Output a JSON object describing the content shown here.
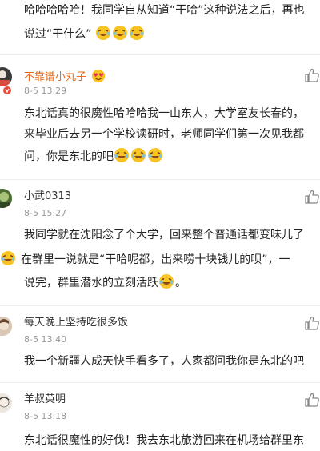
{
  "top": {
    "line1": "哈哈哈哈哈！我同学自从知道“干哈”这种说法之后，再也",
    "line2": "说过“干什么”"
  },
  "comments": [
    {
      "user": "不靠谱小丸子",
      "time": "8-5 13:29",
      "lines": [
        "东北话真的很魔性哈哈哈我一山东人，大学室友长春的，",
        "来毕业后去另一个学校读研时，老师同学们第一次见我都",
        "问，你是东北的吧"
      ]
    },
    {
      "user": "小武0313",
      "time": "8-5 15:27",
      "lines": [
        "我同学就在沈阳念了个大学，回来整个普通话都变味儿了",
        "在群里一说就是“干哈呢都，出来唠十块钱儿的呗”，一",
        "说完，群里潜水的立刻活跃",
        "。"
      ]
    },
    {
      "user": "每天晚上坚持吃很多饭",
      "time": "8-5 13:40",
      "lines": [
        "我一个新疆人成天快手看多了，人家都问我你是东北的吧"
      ]
    },
    {
      "user": "羊叔英明",
      "time": "8-5 13:18",
      "lines": [
        "东北话很魔性的好伐！我去东北旅游回来在机场给群里东"
      ]
    }
  ],
  "icons": {
    "emoji": "laughing-tears-emoji",
    "heart_eyes": "heart-eyes-emoji",
    "like": "thumbs-up-icon"
  },
  "colors": {
    "orange_username": "#e86b1c",
    "emoji_yellow": "#f7c325"
  }
}
